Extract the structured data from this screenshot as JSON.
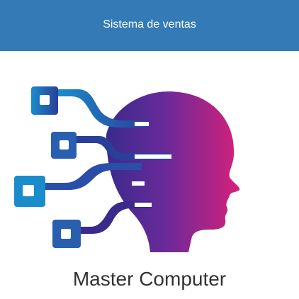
{
  "header": {
    "title": "Sistema de ventas",
    "background": "#337ab7"
  },
  "logo": {
    "icon": "ai-head-circuit-icon",
    "gradient_start": "#1a8ccc",
    "gradient_mid": "#6a2a9a",
    "gradient_end": "#d6207a"
  },
  "brand": {
    "name": "Master Computer"
  }
}
